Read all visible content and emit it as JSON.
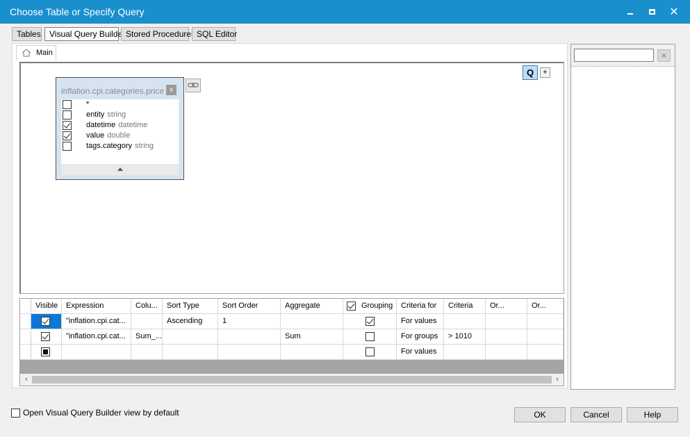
{
  "window": {
    "title": "Choose Table or Specify Query"
  },
  "tabs": [
    {
      "label": "Tables"
    },
    {
      "label": "Visual Query Builder"
    },
    {
      "label": "Stored Procedures"
    },
    {
      "label": "SQL Editor"
    }
  ],
  "inner_tab": {
    "label": "Main"
  },
  "canvas": {
    "q_button": "Q",
    "plus_button": "+",
    "table": {
      "name": "inflation.cpi.categories.price",
      "close": "x",
      "fields": [
        {
          "name": "*",
          "type": "",
          "checked": false
        },
        {
          "name": "entity",
          "type": "string",
          "checked": false
        },
        {
          "name": "datetime",
          "type": "datetime",
          "checked": true
        },
        {
          "name": "value",
          "type": "double",
          "checked": true
        },
        {
          "name": "tags.category",
          "type": "string",
          "checked": false
        }
      ]
    }
  },
  "grid": {
    "headers": [
      "Visible",
      "Expression",
      "Colu...",
      "Sort Type",
      "Sort Order",
      "Aggregate",
      "Grouping",
      "Criteria for",
      "Criteria",
      "Or...",
      "Or..."
    ],
    "rows": [
      {
        "visible": "checked",
        "expression": "\"inflation.cpi.cat...",
        "column": "",
        "sort_type": "Ascending",
        "sort_order": "1",
        "aggregate": "",
        "grouping": true,
        "criteria_for": "For values",
        "criteria": "",
        "or1": "",
        "or2": ""
      },
      {
        "visible": "checked",
        "expression": "\"inflation.cpi.cat...",
        "column": "Sum_...",
        "sort_type": "",
        "sort_order": "",
        "aggregate": "Sum",
        "grouping": false,
        "criteria_for": "For groups",
        "criteria": "> 1010",
        "or1": "",
        "or2": ""
      },
      {
        "visible": "indeterminate",
        "expression": "",
        "column": "",
        "sort_type": "",
        "sort_order": "",
        "aggregate": "",
        "grouping": false,
        "criteria_for": "For values",
        "criteria": "",
        "or1": "",
        "or2": ""
      }
    ]
  },
  "search": {
    "value": "",
    "clear": "×"
  },
  "footer": {
    "default_view_label": "Open Visual Query Builder view by default",
    "ok": "OK",
    "cancel": "Cancel",
    "help": "Help"
  }
}
